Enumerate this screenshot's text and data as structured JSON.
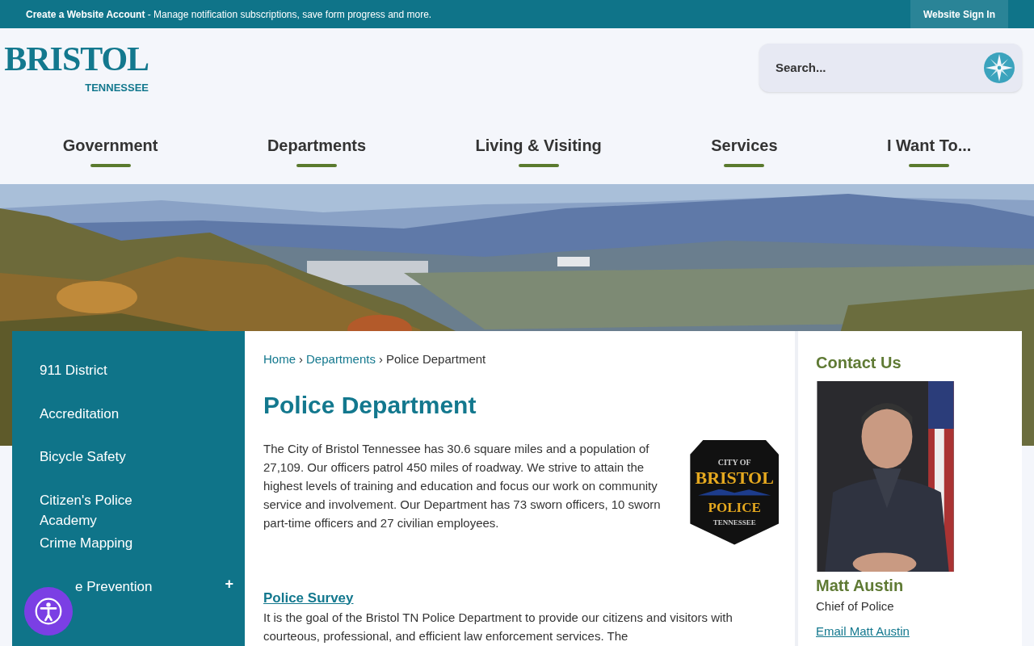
{
  "top_bar": {
    "lead": "Create a Website Account",
    "message": " - Manage notification subscriptions, save form progress and more.",
    "sign_in": "Website Sign In"
  },
  "logo": {
    "name": "BRISTOL",
    "state": "TENNESSEE"
  },
  "search": {
    "placeholder": "Search..."
  },
  "nav": [
    {
      "label": "Government"
    },
    {
      "label": "Departments"
    },
    {
      "label": "Living & Visiting"
    },
    {
      "label": "Services"
    },
    {
      "label": "I Want To..."
    }
  ],
  "sidebar": {
    "items": [
      {
        "label": "911 District"
      },
      {
        "label": "Accreditation"
      },
      {
        "label": "Bicycle Safety"
      },
      {
        "label": "Citizen's Police Academy"
      },
      {
        "label": "Crime Mapping"
      },
      {
        "label": "e Prevention",
        "covered": true,
        "toggle": "+"
      }
    ]
  },
  "breadcrumb": [
    {
      "label": "Home",
      "link": true
    },
    {
      "label": "Departments",
      "link": true
    },
    {
      "label": "Police Department",
      "link": false
    }
  ],
  "breadcrumb_separator": "›",
  "page_title": "Police Department",
  "intro": "The City of Bristol Tennessee has 30.6 square miles and a population of 27,109. Our officers patrol 450 miles of roadway. We strive to attain the highest levels of training and education and focus our work on community service and involvement. Our Department has 73 sworn officers, 10 sworn part-time officers and 27 civilian employees.",
  "badge": {
    "top": "CITY OF",
    "name": "BRISTOL",
    "unit": "POLICE",
    "state": "TENNESSEE"
  },
  "survey": {
    "title": "Police Survey",
    "text": "It is the goal of the Bristol TN Police Department to provide our citizens and visitors with courteous, professional, and efficient law enforcement services.   The"
  },
  "contact": {
    "heading": "Contact Us",
    "name": "Matt Austin",
    "role": "Chief of Police",
    "email": "Email Matt Austin"
  }
}
